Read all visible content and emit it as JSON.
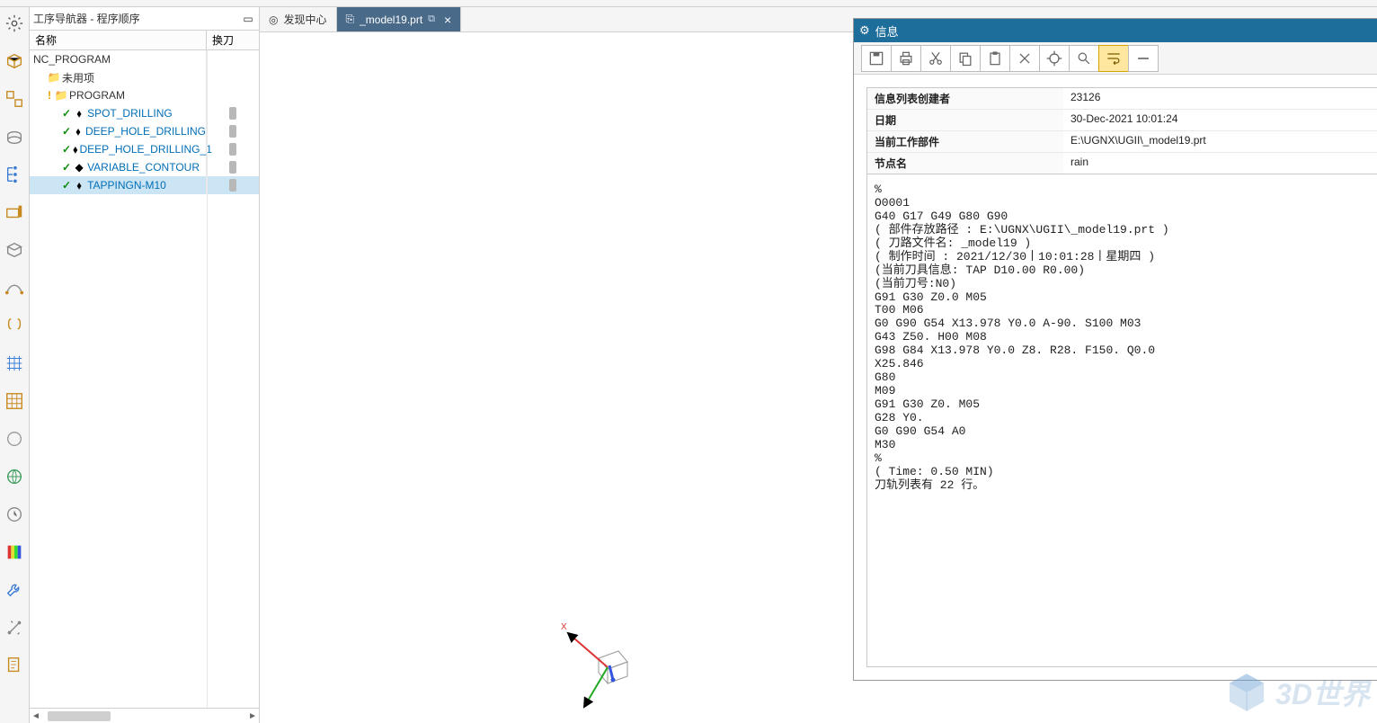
{
  "nav": {
    "title": "工序导航器 - 程序顺序",
    "col_name": "名称",
    "col_tool": "换刀",
    "root": "NC_PROGRAM",
    "unused": "未用项",
    "program": "PROGRAM",
    "ops": [
      "SPOT_DRILLING",
      "DEEP_HOLE_DRILLING",
      "DEEP_HOLE_DRILLING_1",
      "VARIABLE_CONTOUR",
      "TAPPINGN-M10"
    ]
  },
  "tabs": {
    "discover": "发现中心",
    "file": "_model19.prt"
  },
  "info": {
    "title": "信息",
    "meta": {
      "k1": "信息列表创建者",
      "v1": "23126",
      "k2": "日期",
      "v2": "30-Dec-2021 10:01:24",
      "k3": "当前工作部件",
      "v3": "E:\\UGNX\\UGII\\_model19.prt",
      "k4": "节点名",
      "v4": "rain"
    },
    "code": "%\nO0001\nG40 G17 G49 G80 G90\n( 部件存放路径 : E:\\UGNX\\UGII\\_model19.prt )\n( 刀路文件名: _model19 )\n( 制作时间 : 2021/12/30丨10:01:28丨星期四 )\n(当前刀具信息: TAP D10.00 R0.00)\n(当前刀号:N0)\nG91 G30 Z0.0 M05\nT00 M06\nG0 G90 G54 X13.978 Y0.0 A-90. S100 M03\nG43 Z50. H00 M08\nG98 G84 X13.978 Y0.0 Z8. R28. F150. Q0.0\nX25.846\nG80\nM09\nG91 G30 Z0. M05\nG28 Y0.\nG0 G90 G54 A0\nM30\n%\n( Time: 0.50 MIN)\n刀轨列表有 22 行。"
  },
  "wm": "3D世界",
  "footer": ""
}
